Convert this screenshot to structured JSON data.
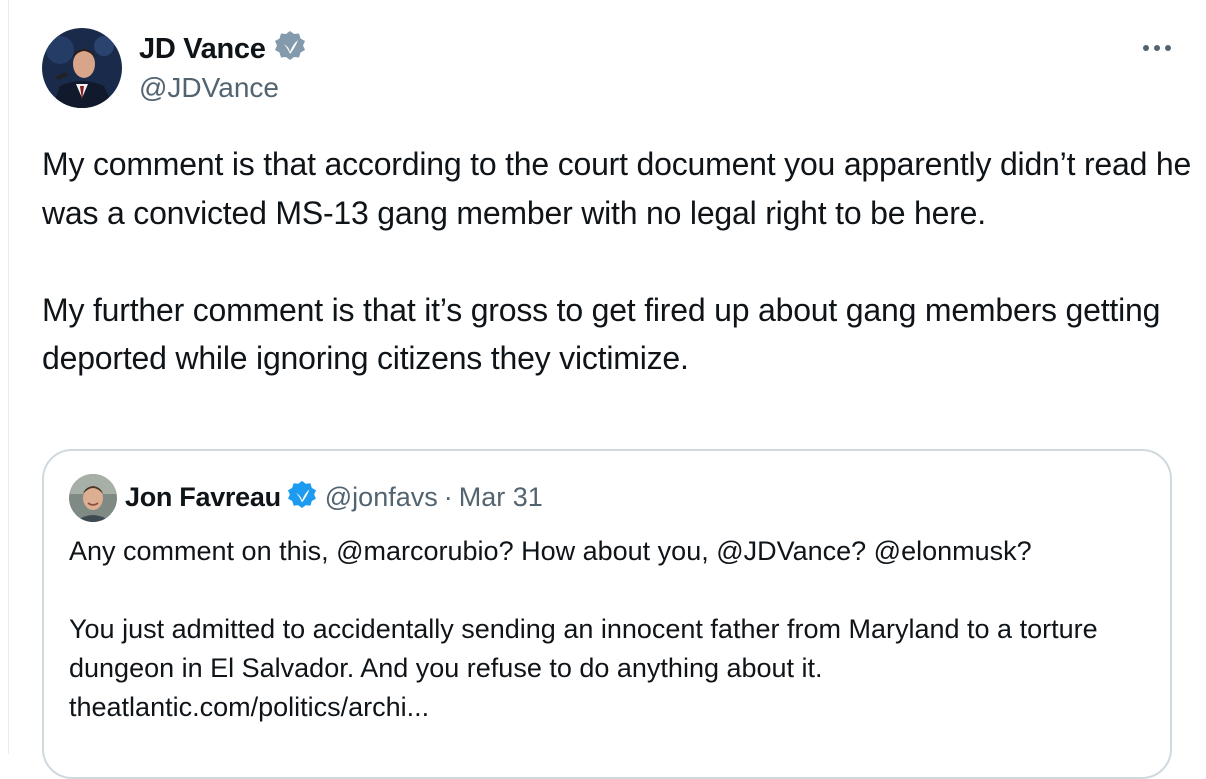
{
  "tweet": {
    "author": {
      "name": "JD Vance",
      "handle": "@JDVance",
      "verified_icon": "verified-badge-icon",
      "badge_color": "#829aab"
    },
    "more_icon": "more-horizontal-icon",
    "paragraphs": [
      "My comment is that according to the court document you apparently didn’t read he was a convicted MS-13 gang member with no legal right to be here.",
      "My further comment is that it’s gross to get fired up about gang members getting deported while ignoring citizens they victimize."
    ]
  },
  "quoted_tweet": {
    "author": {
      "name": "Jon Favreau",
      "handle": "@jonfavs",
      "verified_icon": "verified-badge-icon",
      "badge_color": "#1d9bf0"
    },
    "separator": "·",
    "date": "Mar 31",
    "paragraph_1": "Any comment on this, @marcorubio? How about you, @JDVance? @elonmusk?",
    "paragraph_2": "You just admitted to accidentally sending an innocent father from Maryland to a torture dungeon in El Salvador. And you refuse to do anything about it.",
    "link": "theatlantic.com/politics/archi..."
  }
}
